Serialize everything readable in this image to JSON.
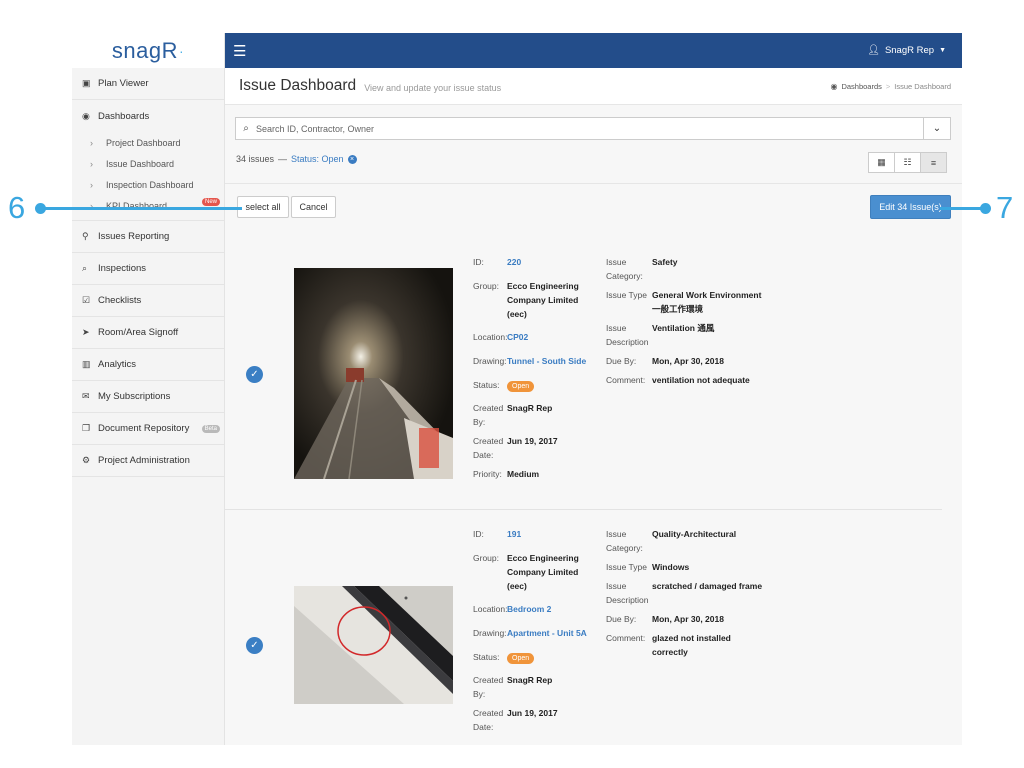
{
  "brand": {
    "logo_text": "snagR"
  },
  "sidebar": {
    "items": [
      {
        "icon": "image-icon",
        "label": "Plan Viewer"
      },
      {
        "icon": "dashboard-icon",
        "label": "Dashboards"
      },
      {
        "icon": "pin-icon",
        "label": "Issues Reporting"
      },
      {
        "icon": "search-icon",
        "label": "Inspections"
      },
      {
        "icon": "checkbox-icon",
        "label": "Checklists"
      },
      {
        "icon": "send-icon",
        "label": "Room/Area Signoff"
      },
      {
        "icon": "bar-chart-icon",
        "label": "Analytics"
      },
      {
        "icon": "envelope-icon",
        "label": "My Subscriptions"
      },
      {
        "icon": "documents-icon",
        "label": "Document Repository",
        "badge": "Beta"
      },
      {
        "icon": "gears-icon",
        "label": "Project Administration"
      }
    ],
    "dashboard_sub": [
      {
        "label": "Project Dashboard"
      },
      {
        "label": "Issue Dashboard"
      },
      {
        "label": "Inspection Dashboard"
      },
      {
        "label": "KPI Dashboard",
        "badge": "New"
      }
    ]
  },
  "topbar": {
    "user_label": "SnagR Rep"
  },
  "header": {
    "title": "Issue Dashboard",
    "subtitle": "View and update your issue status",
    "breadcrumb": [
      "Dashboards",
      "Issue Dashboard"
    ]
  },
  "search": {
    "placeholder": "Search ID, Contractor, Owner"
  },
  "summary": {
    "count_text": "34 issues",
    "dash": "—",
    "status_text": "Status: Open"
  },
  "actions": {
    "select_all": "select all",
    "cancel": "Cancel",
    "edit": "Edit  34 Issue(s)"
  },
  "colors": {
    "accent": "#234d8a",
    "link": "#3a7cc2",
    "open_pill": "#f0943a",
    "callout": "#3aa7e0"
  },
  "labels": {
    "id": "ID:",
    "group": "Group:",
    "location": "Location:",
    "drawing": "Drawing:",
    "status": "Status:",
    "created_by": "Created By:",
    "created_date": "Created Date:",
    "priority": "Priority:",
    "issue_category": "Issue Category:",
    "issue_type": "Issue Type",
    "issue_description": "Issue Description",
    "due_by": "Due By:",
    "comment": "Comment:"
  },
  "issues": [
    {
      "id": "220",
      "group": "Ecco Engineering Company Limited (eec)",
      "location": "CP02",
      "drawing": "Tunnel - South Side",
      "status": "Open",
      "created_by": "SnagR Rep",
      "created_date": "Jun 19, 2017",
      "priority": "Medium",
      "category": "Safety",
      "type": "General Work Environment 一般工作環境",
      "description": "Ventilation 通風",
      "due_by": "Mon, Apr 30, 2018",
      "comment": "ventilation not adequate"
    },
    {
      "id": "191",
      "group": "Ecco Engineering Company Limited (eec)",
      "location": "Bedroom 2",
      "drawing": "Apartment - Unit 5A",
      "status": "Open",
      "created_by": "SnagR Rep",
      "created_date": "Jun 19, 2017",
      "category": "Quality-Architectural",
      "type": "Windows",
      "description": "scratched / damaged frame",
      "due_by": "Mon, Apr 30, 2018",
      "comment": "glazed not installed correctly"
    }
  ],
  "callouts": {
    "left": "6",
    "right": "7"
  }
}
